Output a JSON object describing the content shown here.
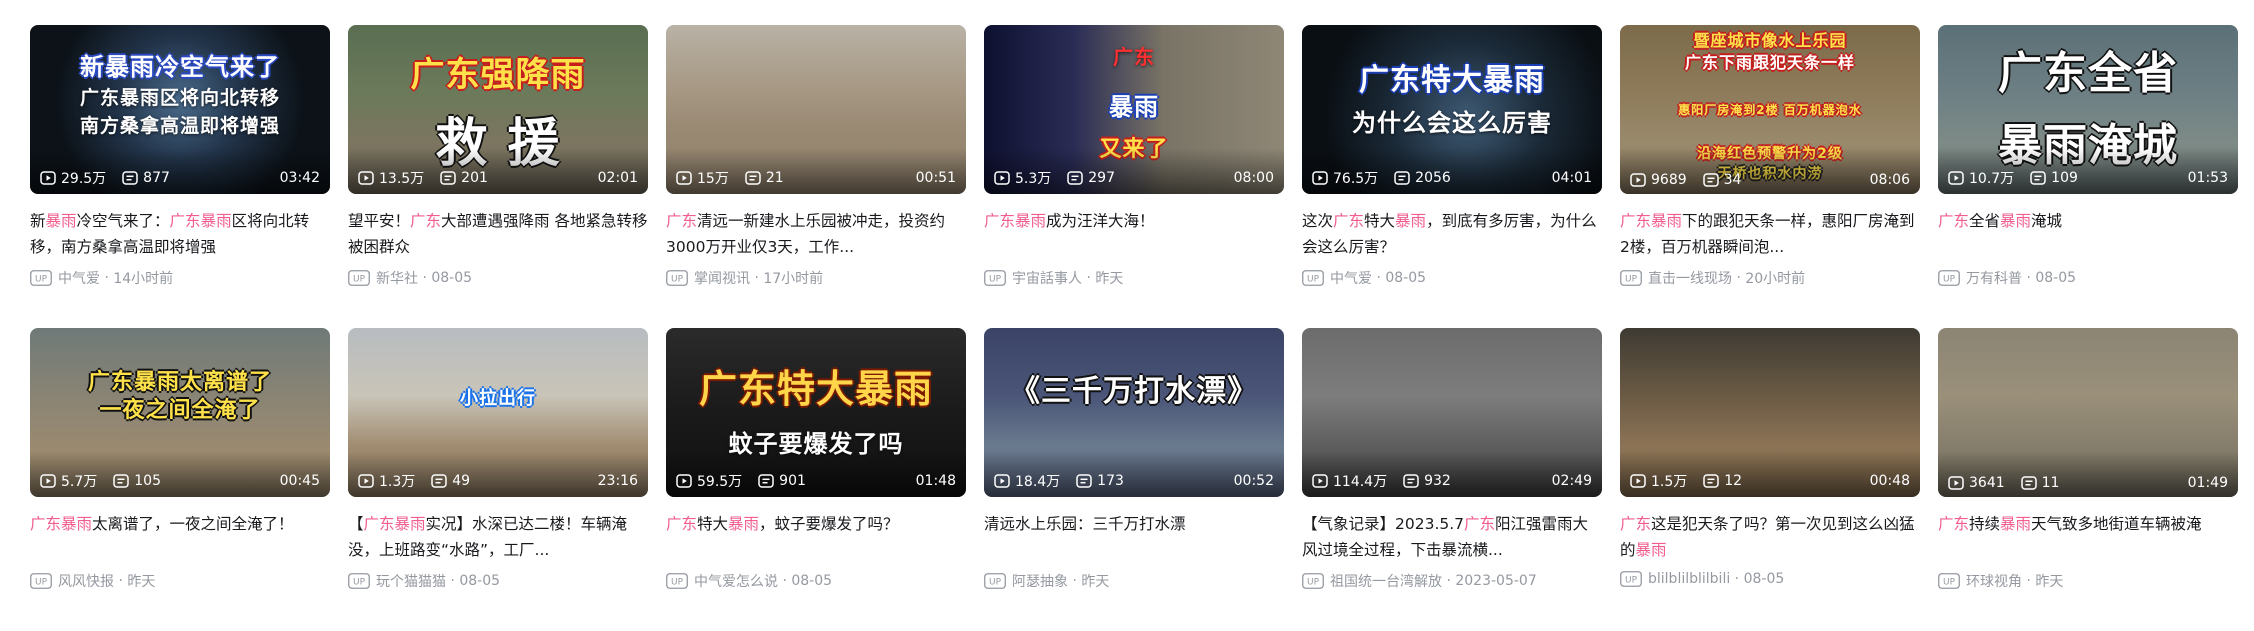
{
  "colors": {
    "accent": "#f25d8e",
    "meta": "#9499a0",
    "title": "#18191c"
  },
  "icons": {
    "views": "play-count-icon",
    "comments": "danmaku-icon",
    "uploader": "up-badge-icon"
  },
  "videos": [
    {
      "overlay": [
        "新暴雨冷空气来了",
        "广东暴雨区将向北转移",
        "南方桑拿高温即将增强"
      ],
      "views": "29.5万",
      "comments": "877",
      "duration": "03:42",
      "title": [
        {
          "t": "新"
        },
        {
          "t": "暴雨",
          "hl": true
        },
        {
          "t": "冷空气来了：",
          "hl": false
        },
        {
          "t": "广东",
          "hl": true
        },
        {
          "t": "暴雨",
          "hl": true
        },
        {
          "t": "区将向北转移，南方桑拿高温即将增强"
        }
      ],
      "author": "中气爱",
      "time": "14小时前",
      "bg": "radial-gradient(circle at 50% 45%, #4a6b8c 0%, #22344a 35%, #0c1218 70%)"
    },
    {
      "overlay": [
        "广东强降雨",
        "救  援"
      ],
      "views": "13.5万",
      "comments": "201",
      "duration": "02:01",
      "title": [
        {
          "t": "望平安！"
        },
        {
          "t": "广东",
          "hl": true
        },
        {
          "t": "大部遭遇强降雨 各地紧急转移被困群众"
        }
      ],
      "author": "新华社",
      "time": "08-05",
      "bg": "linear-gradient(180deg, #5a6e52 0%, #6b7a5a 40%, #7c7560 70%, #6a6356 100%)"
    },
    {
      "overlay": [],
      "views": "15万",
      "comments": "21",
      "duration": "00:51",
      "title": [
        {
          "t": "广东",
          "hl": true
        },
        {
          "t": "清远一新建水上乐园被冲走，投资约3000万开业仅3天，工作..."
        }
      ],
      "author": "掌闻视讯",
      "time": "17小时前",
      "bg": "linear-gradient(180deg, #b9b2a6 0%, #a89a86 35%, #9a8a74 60%, #8e7f6a 100%)"
    },
    {
      "overlay": [
        "广东",
        "暴雨",
        "又来了"
      ],
      "views": "5.3万",
      "comments": "297",
      "duration": "08:00",
      "title": [
        {
          "t": "广东",
          "hl": true
        },
        {
          "t": "暴雨",
          "hl": true
        },
        {
          "t": "成为汪洋大海！"
        }
      ],
      "author": "宇宙話事人",
      "time": "昨天",
      "bg": "linear-gradient(90deg, #0e1030 0%, #2a2c55 30%, #7a7466 60%, #8e8776 100%)"
    },
    {
      "overlay": [
        "广东特大暴雨",
        "为什么会这么厉害"
      ],
      "views": "76.5万",
      "comments": "2056",
      "duration": "04:01",
      "title": [
        {
          "t": "这次"
        },
        {
          "t": "广东",
          "hl": true
        },
        {
          "t": "特大"
        },
        {
          "t": "暴雨",
          "hl": true
        },
        {
          "t": "，到底有多厉害，为什么会这么厉害？"
        }
      ],
      "author": "中气爱",
      "time": "08-05",
      "bg": "radial-gradient(circle at 55% 55%, #3e5a74 0%, #1b2a38 40%, #0a0f14 75%)"
    },
    {
      "overlay": [
        "暨座城市像水上乐园",
        "广东下雨跟犯天条一样",
        "惠阳厂房淹到2楼 百万机器泡水",
        "沿海红色预警升为2级",
        "天桥也积水内涝"
      ],
      "views": "9689",
      "comments": "34",
      "duration": "08:06",
      "title": [
        {
          "t": "广东",
          "hl": true
        },
        {
          "t": "暴雨",
          "hl": true
        },
        {
          "t": "下的跟犯天条一样，惠阳厂房淹到2楼，百万机器瞬间泡..."
        }
      ],
      "author": "直击一线现场",
      "time": "20小时前",
      "bg": "linear-gradient(180deg, #7c6b4a 0%, #8d7b5a 40%, #9a8a6c 70%, #7e6f58 100%)"
    },
    {
      "overlay": [
        "广东全省",
        "暴雨淹城"
      ],
      "views": "10.7万",
      "comments": "109",
      "duration": "01:53",
      "title": [
        {
          "t": "广东",
          "hl": true
        },
        {
          "t": "全省"
        },
        {
          "t": "暴雨",
          "hl": true
        },
        {
          "t": "淹城"
        }
      ],
      "author": "万有科普",
      "time": "08-05",
      "bg": "linear-gradient(180deg, #5b7077 0%, #6f8185 45%, #7e8a86 70%, #5f6b6a 100%)"
    },
    {
      "overlay": [
        "广东暴雨太离谱了",
        "一夜之间全淹了"
      ],
      "views": "5.7万",
      "comments": "105",
      "duration": "00:45",
      "title": [
        {
          "t": "广东",
          "hl": true
        },
        {
          "t": "暴雨",
          "hl": true
        },
        {
          "t": "太离谱了，一夜之间全淹了！"
        }
      ],
      "author": "风风快报",
      "time": "昨天",
      "bg": "linear-gradient(180deg, #6f7a78 0%, #8c8574 45%, #9c8a6e 75%, #8a7a62 100%)"
    },
    {
      "overlay": [
        "小拉出行"
      ],
      "views": "1.3万",
      "comments": "49",
      "duration": "23:16",
      "title": [
        {
          "t": "【"
        },
        {
          "t": "广东",
          "hl": true
        },
        {
          "t": "暴雨",
          "hl": true
        },
        {
          "t": "实况】水深已达二楼！车辆淹没，上班路变“水路”，工厂..."
        }
      ],
      "author": "玩个猫猫猫",
      "time": "08-05",
      "bg": "linear-gradient(180deg, #b8bcc0 0%, #c9c4b8 40%, #a08c70 70%, #8a7860 100%)"
    },
    {
      "overlay": [
        "广东特大暴雨",
        "蚊子要爆发了吗"
      ],
      "views": "59.5万",
      "comments": "901",
      "duration": "01:48",
      "title": [
        {
          "t": "广东",
          "hl": true
        },
        {
          "t": "特大"
        },
        {
          "t": "暴雨",
          "hl": true
        },
        {
          "t": "，蚊子要爆发了吗？"
        }
      ],
      "author": "中气爱怎么说",
      "time": "08-05",
      "bg": "linear-gradient(180deg, #2b2b2b 0%, #1a1a1a 50%, #101010 100%)"
    },
    {
      "overlay": [
        "《三千万打水漂》"
      ],
      "views": "18.4万",
      "comments": "173",
      "duration": "00:52",
      "title": [
        {
          "t": "清远水上乐园：三千万打水漂"
        }
      ],
      "author": "阿瑟抽象",
      "time": "昨天",
      "bg": "linear-gradient(180deg, #3b4466 0%, #4a5578 40%, #6a7a8e 70%, #55607a 100%)"
    },
    {
      "overlay": [],
      "views": "114.4万",
      "comments": "932",
      "duration": "02:49",
      "title": [
        {
          "t": "【气象记录】2023.5.7"
        },
        {
          "t": "广东",
          "hl": true
        },
        {
          "t": "阳江强雷雨大风过境全过程，下击暴流横..."
        }
      ],
      "author": "祖国统一台湾解放",
      "time": "2023-05-07",
      "bg": "linear-gradient(180deg, #6c6c6c 0%, #7d7d7d 40%, #5e5e5e 70%, #3c3c3c 100%)"
    },
    {
      "overlay": [],
      "views": "1.5万",
      "comments": "12",
      "duration": "00:48",
      "title": [
        {
          "t": "广东",
          "hl": true
        },
        {
          "t": "这是犯天条了吗？第一次见到这么凶猛的"
        },
        {
          "t": "暴雨",
          "hl": true
        }
      ],
      "author": "blilblilblilbili",
      "time": "08-05",
      "bg": "linear-gradient(180deg, #3e3a32 0%, #6a5a44 40%, #8c7356 70%, #7a6448 100%)"
    },
    {
      "overlay": [],
      "views": "3641",
      "comments": "11",
      "duration": "01:49",
      "title": [
        {
          "t": "广东",
          "hl": true
        },
        {
          "t": "持续"
        },
        {
          "t": "暴雨",
          "hl": true
        },
        {
          "t": "天气致多地街道车辆被淹"
        }
      ],
      "author": "环球视角",
      "time": "昨天",
      "bg": "linear-gradient(180deg, #8c8574 0%, #9a907a 40%, #867e6c 70%, #6f6a5c 100%)"
    }
  ]
}
